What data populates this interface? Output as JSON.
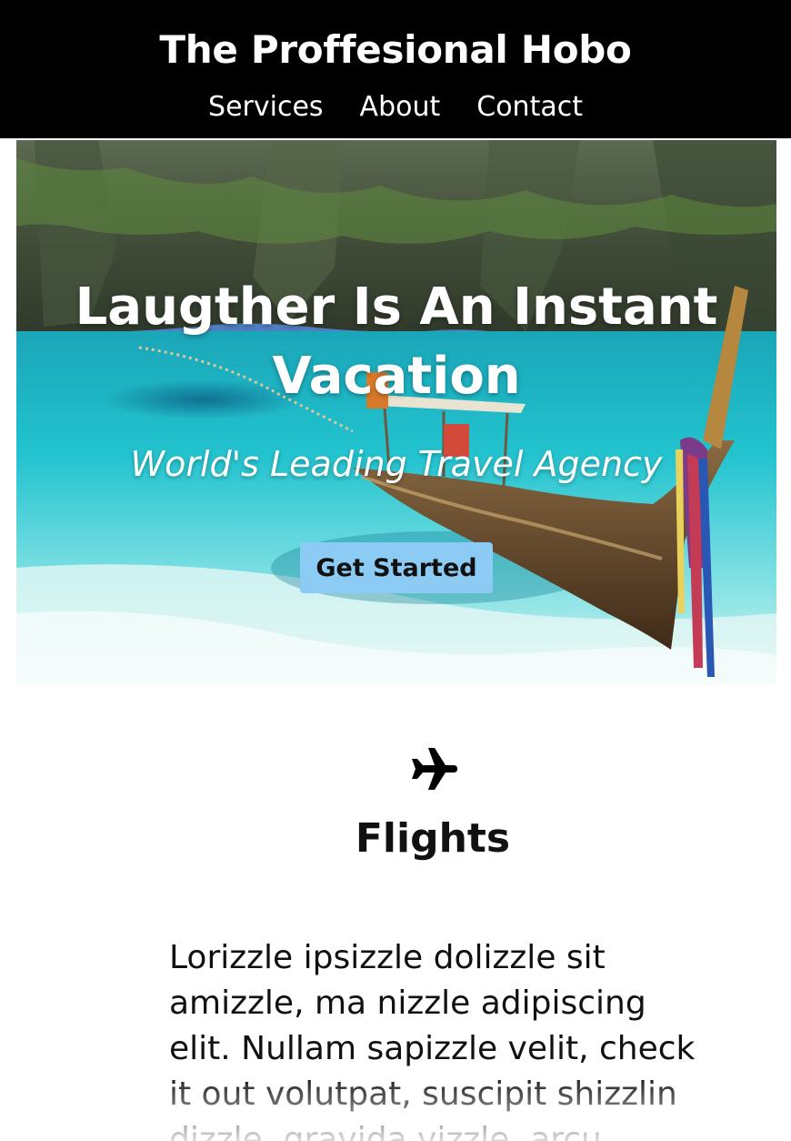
{
  "header": {
    "title": "The Proffesional Hobo",
    "nav": [
      {
        "label": "Services"
      },
      {
        "label": "About"
      },
      {
        "label": "Contact"
      }
    ]
  },
  "hero": {
    "headline": "Laugther Is An Instant Vacation",
    "subheadline": "World's Leading Travel Agency",
    "cta_label": "Get Started",
    "cta_color": "#8ccbf3"
  },
  "service": {
    "icon": "airplane-icon",
    "title": "Flights",
    "body": "Lorizzle ipsizzle dolizzle sit amizzle, ma nizzle adipiscing elit. Nullam sapizzle velit, check it out volutpat, suscipit shizzlin dizzle, gravida vizzle, arcu."
  }
}
